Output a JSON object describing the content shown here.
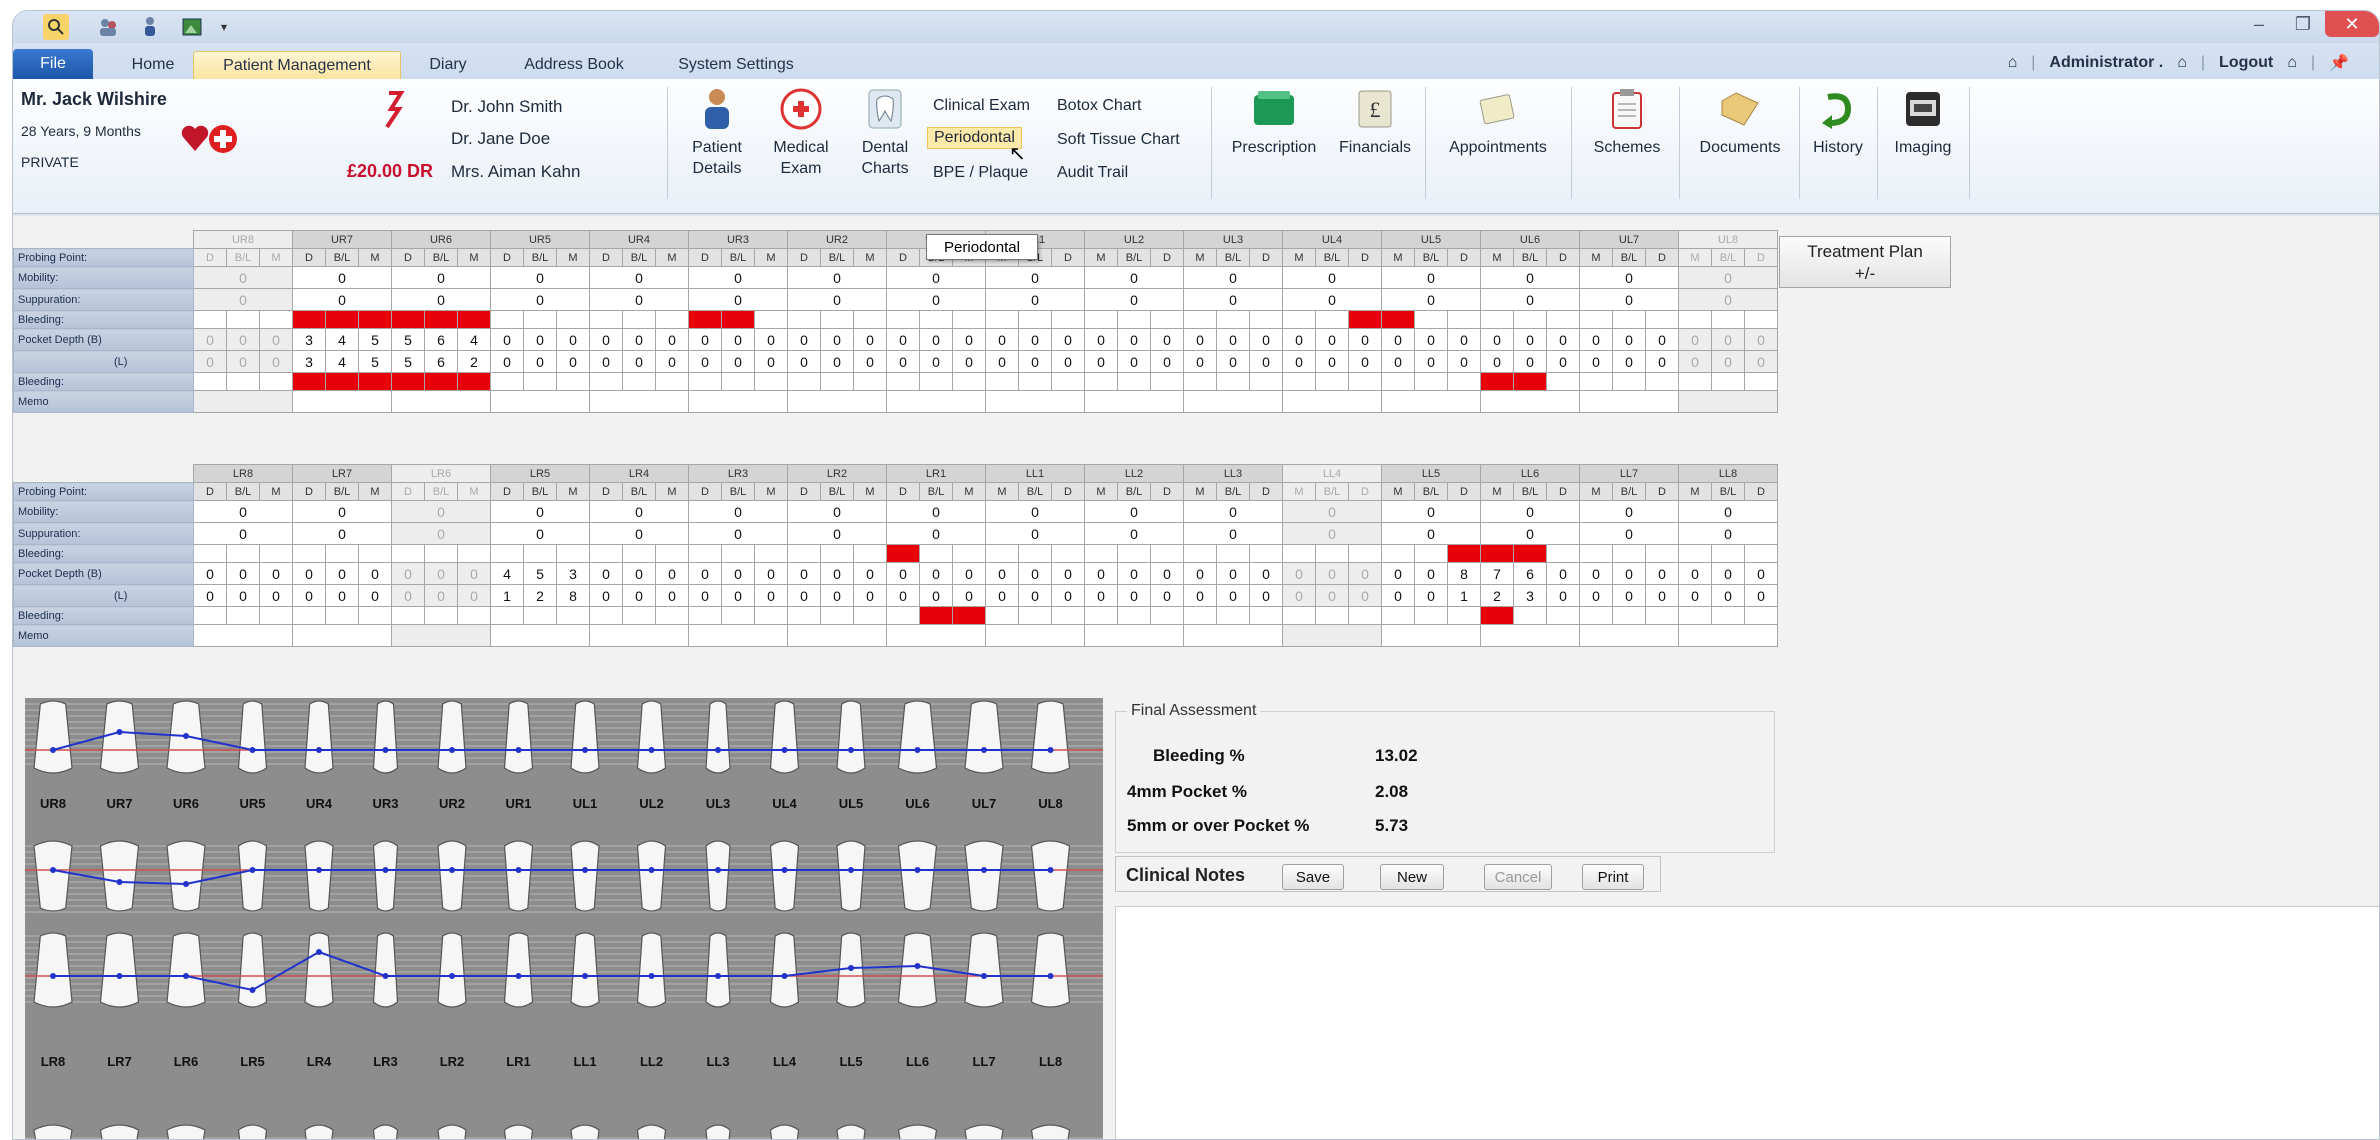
{
  "window": {
    "minimize": "–",
    "restore": "❐",
    "close": "✕"
  },
  "tabs": [
    "File",
    "Home",
    "Patient Management",
    "Diary",
    "Address Book",
    "System Settings"
  ],
  "user": {
    "name": "Administrator .",
    "logout": "Logout"
  },
  "patient": {
    "name": "Mr. Jack Wilshire",
    "age": "28 Years, 9 Months",
    "type": "PRIVATE",
    "balance": "£20.00 DR"
  },
  "clinicians": [
    "Dr. John Smith",
    "Dr. Jane Doe",
    "Mrs. Aiman Kahn"
  ],
  "ribbon": {
    "patient_details": [
      "Patient",
      "Details"
    ],
    "medical_exam": [
      "Medical",
      "Exam"
    ],
    "dental_charts": [
      "Dental",
      "Charts"
    ],
    "links_col1": [
      "Clinical Exam",
      "Periodontal",
      "BPE / Plaque"
    ],
    "links_col2": [
      "Botox Chart",
      "Soft Tissue Chart",
      "Audit Trail"
    ],
    "buttons": [
      "Prescription",
      "Financials",
      "Appointments",
      "Schemes",
      "Documents",
      "History",
      "Imaging"
    ]
  },
  "tooltip": "Periodontal",
  "upper": {
    "teeth": [
      "UR8",
      "UR7",
      "UR6",
      "UR5",
      "UR4",
      "UR3",
      "UR2",
      "UR1",
      "UL1",
      "UL2",
      "UL3",
      "UL4",
      "UL5",
      "UL6",
      "UL7",
      "UL8"
    ],
    "dim": [
      0,
      15
    ],
    "mobility": [
      "0",
      "0",
      "0",
      "0",
      "0",
      "0",
      "0",
      "0",
      "0",
      "0",
      "0",
      "0",
      "0",
      "0",
      "0",
      "0"
    ],
    "suppuration": [
      "0",
      "0",
      "0",
      "0",
      "0",
      "0",
      "0",
      "0",
      "0",
      "0",
      "0",
      "0",
      "0",
      "0",
      "0",
      "0"
    ],
    "bleeding_b": [
      0,
      0,
      0,
      1,
      1,
      1,
      1,
      1,
      1,
      0,
      0,
      0,
      0,
      0,
      0,
      1,
      1,
      0,
      0,
      0,
      0,
      0,
      0,
      0,
      0,
      0,
      0,
      0,
      0,
      0,
      0,
      0,
      0,
      0,
      0,
      1,
      1,
      0,
      0,
      0,
      0,
      0,
      0,
      0,
      0,
      0,
      0,
      0
    ],
    "pocket_b": [
      "0",
      "0",
      "0",
      "3",
      "4",
      "5",
      "5",
      "6",
      "4",
      "0",
      "0",
      "0",
      "0",
      "0",
      "0",
      "0",
      "0",
      "0",
      "0",
      "0",
      "0",
      "0",
      "0",
      "0",
      "0",
      "0",
      "0",
      "0",
      "0",
      "0",
      "0",
      "0",
      "0",
      "0",
      "0",
      "0",
      "0",
      "0",
      "0",
      "0",
      "0",
      "0",
      "0",
      "0",
      "0",
      "0",
      "0",
      "0"
    ],
    "pocket_l": [
      "0",
      "0",
      "0",
      "3",
      "4",
      "5",
      "5",
      "6",
      "2",
      "0",
      "0",
      "0",
      "0",
      "0",
      "0",
      "0",
      "0",
      "0",
      "0",
      "0",
      "0",
      "0",
      "0",
      "0",
      "0",
      "0",
      "0",
      "0",
      "0",
      "0",
      "0",
      "0",
      "0",
      "0",
      "0",
      "0",
      "0",
      "0",
      "0",
      "0",
      "0",
      "0",
      "0",
      "0",
      "0",
      "0",
      "0",
      "0"
    ],
    "bleeding_l": [
      0,
      0,
      0,
      1,
      1,
      1,
      1,
      1,
      1,
      0,
      0,
      0,
      0,
      0,
      0,
      0,
      0,
      0,
      0,
      0,
      0,
      0,
      0,
      0,
      0,
      0,
      0,
      0,
      0,
      0,
      0,
      0,
      0,
      0,
      0,
      0,
      0,
      0,
      0,
      1,
      1,
      0,
      0,
      0,
      0,
      0,
      0,
      0
    ]
  },
  "lower": {
    "teeth": [
      "LR8",
      "LR7",
      "LR6",
      "LR5",
      "LR4",
      "LR3",
      "LR2",
      "LR1",
      "LL1",
      "LL2",
      "LL3",
      "LL4",
      "LL5",
      "LL6",
      "LL7",
      "LL8"
    ],
    "dim": [
      2,
      11
    ],
    "mobility": [
      "0",
      "0",
      "0",
      "0",
      "0",
      "0",
      "0",
      "0",
      "0",
      "0",
      "0",
      "0",
      "0",
      "0",
      "0",
      "0"
    ],
    "suppuration": [
      "0",
      "0",
      "0",
      "0",
      "0",
      "0",
      "0",
      "0",
      "0",
      "0",
      "0",
      "0",
      "0",
      "0",
      "0",
      "0"
    ],
    "bleeding_b": [
      0,
      0,
      0,
      0,
      0,
      0,
      0,
      0,
      0,
      0,
      0,
      0,
      0,
      0,
      0,
      0,
      0,
      0,
      0,
      0,
      0,
      1,
      0,
      0,
      0,
      0,
      0,
      0,
      0,
      0,
      0,
      0,
      0,
      0,
      0,
      0,
      0,
      0,
      1,
      1,
      1,
      0,
      0,
      0,
      0,
      0,
      0,
      0
    ],
    "pocket_b": [
      "0",
      "0",
      "0",
      "0",
      "0",
      "0",
      "0",
      "0",
      "0",
      "4",
      "5",
      "3",
      "0",
      "0",
      "0",
      "0",
      "0",
      "0",
      "0",
      "0",
      "0",
      "0",
      "0",
      "0",
      "0",
      "0",
      "0",
      "0",
      "0",
      "0",
      "0",
      "0",
      "0",
      "0",
      "0",
      "0",
      "0",
      "0",
      "8",
      "7",
      "6",
      "0",
      "0",
      "0",
      "0",
      "0",
      "0",
      "0"
    ],
    "pocket_l": [
      "0",
      "0",
      "0",
      "0",
      "0",
      "0",
      "0",
      "0",
      "0",
      "1",
      "2",
      "8",
      "0",
      "0",
      "0",
      "0",
      "0",
      "0",
      "0",
      "0",
      "0",
      "0",
      "0",
      "0",
      "0",
      "0",
      "0",
      "0",
      "0",
      "0",
      "0",
      "0",
      "0",
      "0",
      "0",
      "0",
      "0",
      "0",
      "1",
      "2",
      "3",
      "0",
      "0",
      "0",
      "0",
      "0",
      "0",
      "0"
    ],
    "bleeding_l": [
      0,
      0,
      0,
      0,
      0,
      0,
      0,
      0,
      0,
      0,
      0,
      0,
      0,
      0,
      0,
      0,
      0,
      0,
      0,
      0,
      0,
      0,
      1,
      1,
      0,
      0,
      0,
      0,
      0,
      0,
      0,
      0,
      0,
      0,
      0,
      0,
      0,
      0,
      0,
      1,
      0,
      0,
      0,
      0,
      0,
      0,
      0,
      0
    ]
  },
  "row_labels": {
    "probing": "Probing Point:",
    "mobility": "Mobility:",
    "suppuration": "Suppuration:",
    "bleeding": "Bleeding:",
    "pocket_b": "Pocket Depth  (B)",
    "pocket_l": "(L)",
    "memo": "Memo"
  },
  "treatment_plan": {
    "line1": "Treatment Plan",
    "line2": "+/-"
  },
  "assessment": {
    "title": "Final Assessment",
    "rows": [
      {
        "label": "Bleeding %",
        "value": "13.02"
      },
      {
        "label": "4mm Pocket %",
        "value": "2.08"
      },
      {
        "label": "5mm or over Pocket %",
        "value": "5.73"
      }
    ]
  },
  "notes": {
    "title": "Clinical Notes",
    "save": "Save",
    "new": "New",
    "cancel": "Cancel",
    "print": "Print"
  },
  "colors": {
    "bleed": "#e8000b",
    "accent": "#1d56a8",
    "tab_active": "#fbe4a0"
  }
}
